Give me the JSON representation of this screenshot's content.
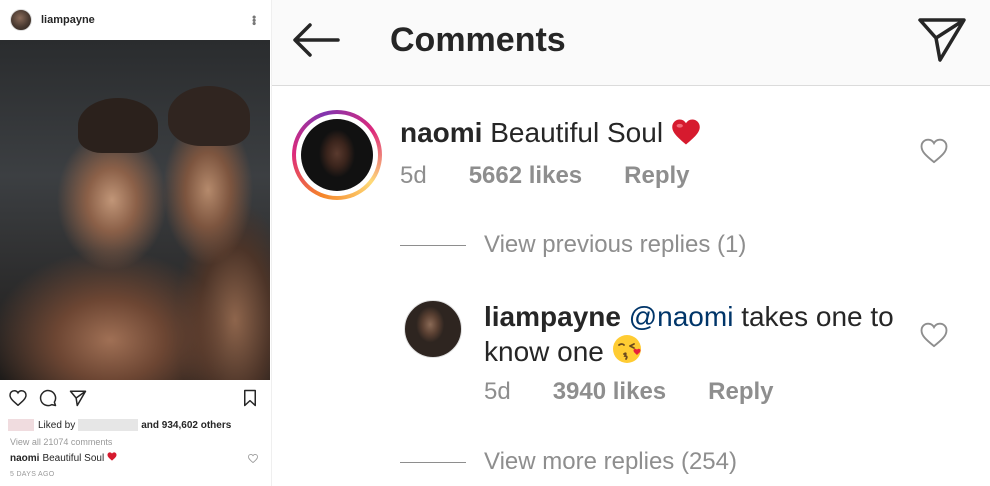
{
  "post": {
    "username": "liampayne",
    "liked_by_prefix": "Liked by",
    "liked_by_suffix": "and 934,602 others",
    "view_all_comments": "View all 21074 comments",
    "top_comment": {
      "username": "naomi",
      "text": "Beautiful Soul"
    },
    "timestamp": "5 DAYS AGO"
  },
  "header": {
    "title": "Comments"
  },
  "comments": [
    {
      "username": "naomi",
      "text": "Beautiful Soul",
      "emoji": "red-heart",
      "time": "5d",
      "likes": "5662 likes",
      "reply_label": "Reply"
    }
  ],
  "view_previous_replies": "View previous replies (1)",
  "replies": [
    {
      "username": "liampayne",
      "mention": "@naomi",
      "text_line1": "takes one to",
      "text_line2": "know one",
      "emoji": "kissing-face",
      "time": "5d",
      "likes": "3940 likes",
      "reply_label": "Reply"
    }
  ],
  "view_more_replies": "View more replies (254)",
  "colors": {
    "accent_text": "#262626",
    "secondary_text": "#8e8e8e",
    "mention": "#003569",
    "heart": "#d61a2e",
    "story_ring": [
      "#f58529",
      "#dd2a7b",
      "#8134af",
      "#feda77"
    ]
  }
}
